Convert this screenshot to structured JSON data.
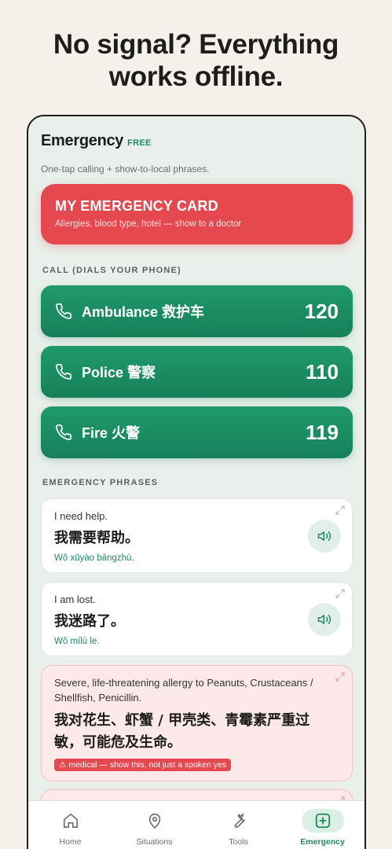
{
  "headline": {
    "line1": "No signal? Everything",
    "line2": "works offline."
  },
  "header": {
    "title": "Emergency",
    "badge": "FREE",
    "subtitle": "One-tap calling + show-to-local phrases."
  },
  "emergency_card": {
    "title": "MY EMERGENCY CARD",
    "subtitle": "Allergies, blood type, hotel — show to a doctor"
  },
  "call_section": {
    "label": "CALL (DIALS YOUR PHONE)",
    "buttons": [
      {
        "label": "Ambulance 救护车",
        "number": "120"
      },
      {
        "label": "Police 警察",
        "number": "110"
      },
      {
        "label": "Fire 火警",
        "number": "119"
      }
    ]
  },
  "phrases_section": {
    "label": "EMERGENCY PHRASES",
    "phrases": [
      {
        "en": "I need help.",
        "zh": "我需要帮助。",
        "pinyin": "Wǒ xūyào bāngzhù."
      },
      {
        "en": "I am lost.",
        "zh": "我迷路了。",
        "pinyin": "Wǒ mílù le."
      }
    ],
    "allergy": {
      "en_line1": "Severe, life-threatening allergy to Peanuts, Crustaceans /",
      "en_line2": "Shellfish, Penicillin.",
      "zh_line1": "我对花生、虾蟹 / 甲壳类、青霉素严重过",
      "zh_line2": "敏，可能危及生命。",
      "badge": "⚠ medical — show this, not just a spoken yes"
    }
  },
  "tabbar": {
    "tabs": [
      {
        "label": "Home",
        "icon": "home-icon"
      },
      {
        "label": "Situations",
        "icon": "location-pin-icon"
      },
      {
        "label": "Tools",
        "icon": "wrench-icon"
      },
      {
        "label": "Emergency",
        "icon": "plus-square-icon",
        "active": true
      }
    ]
  },
  "colors": {
    "background": "#f5f1ea",
    "screen": "#e9efea",
    "accent_green": "#1f8a63",
    "call_green": "#1a8c62",
    "emergency_red": "#e5484f",
    "allergy_pink": "#fde9ea"
  }
}
